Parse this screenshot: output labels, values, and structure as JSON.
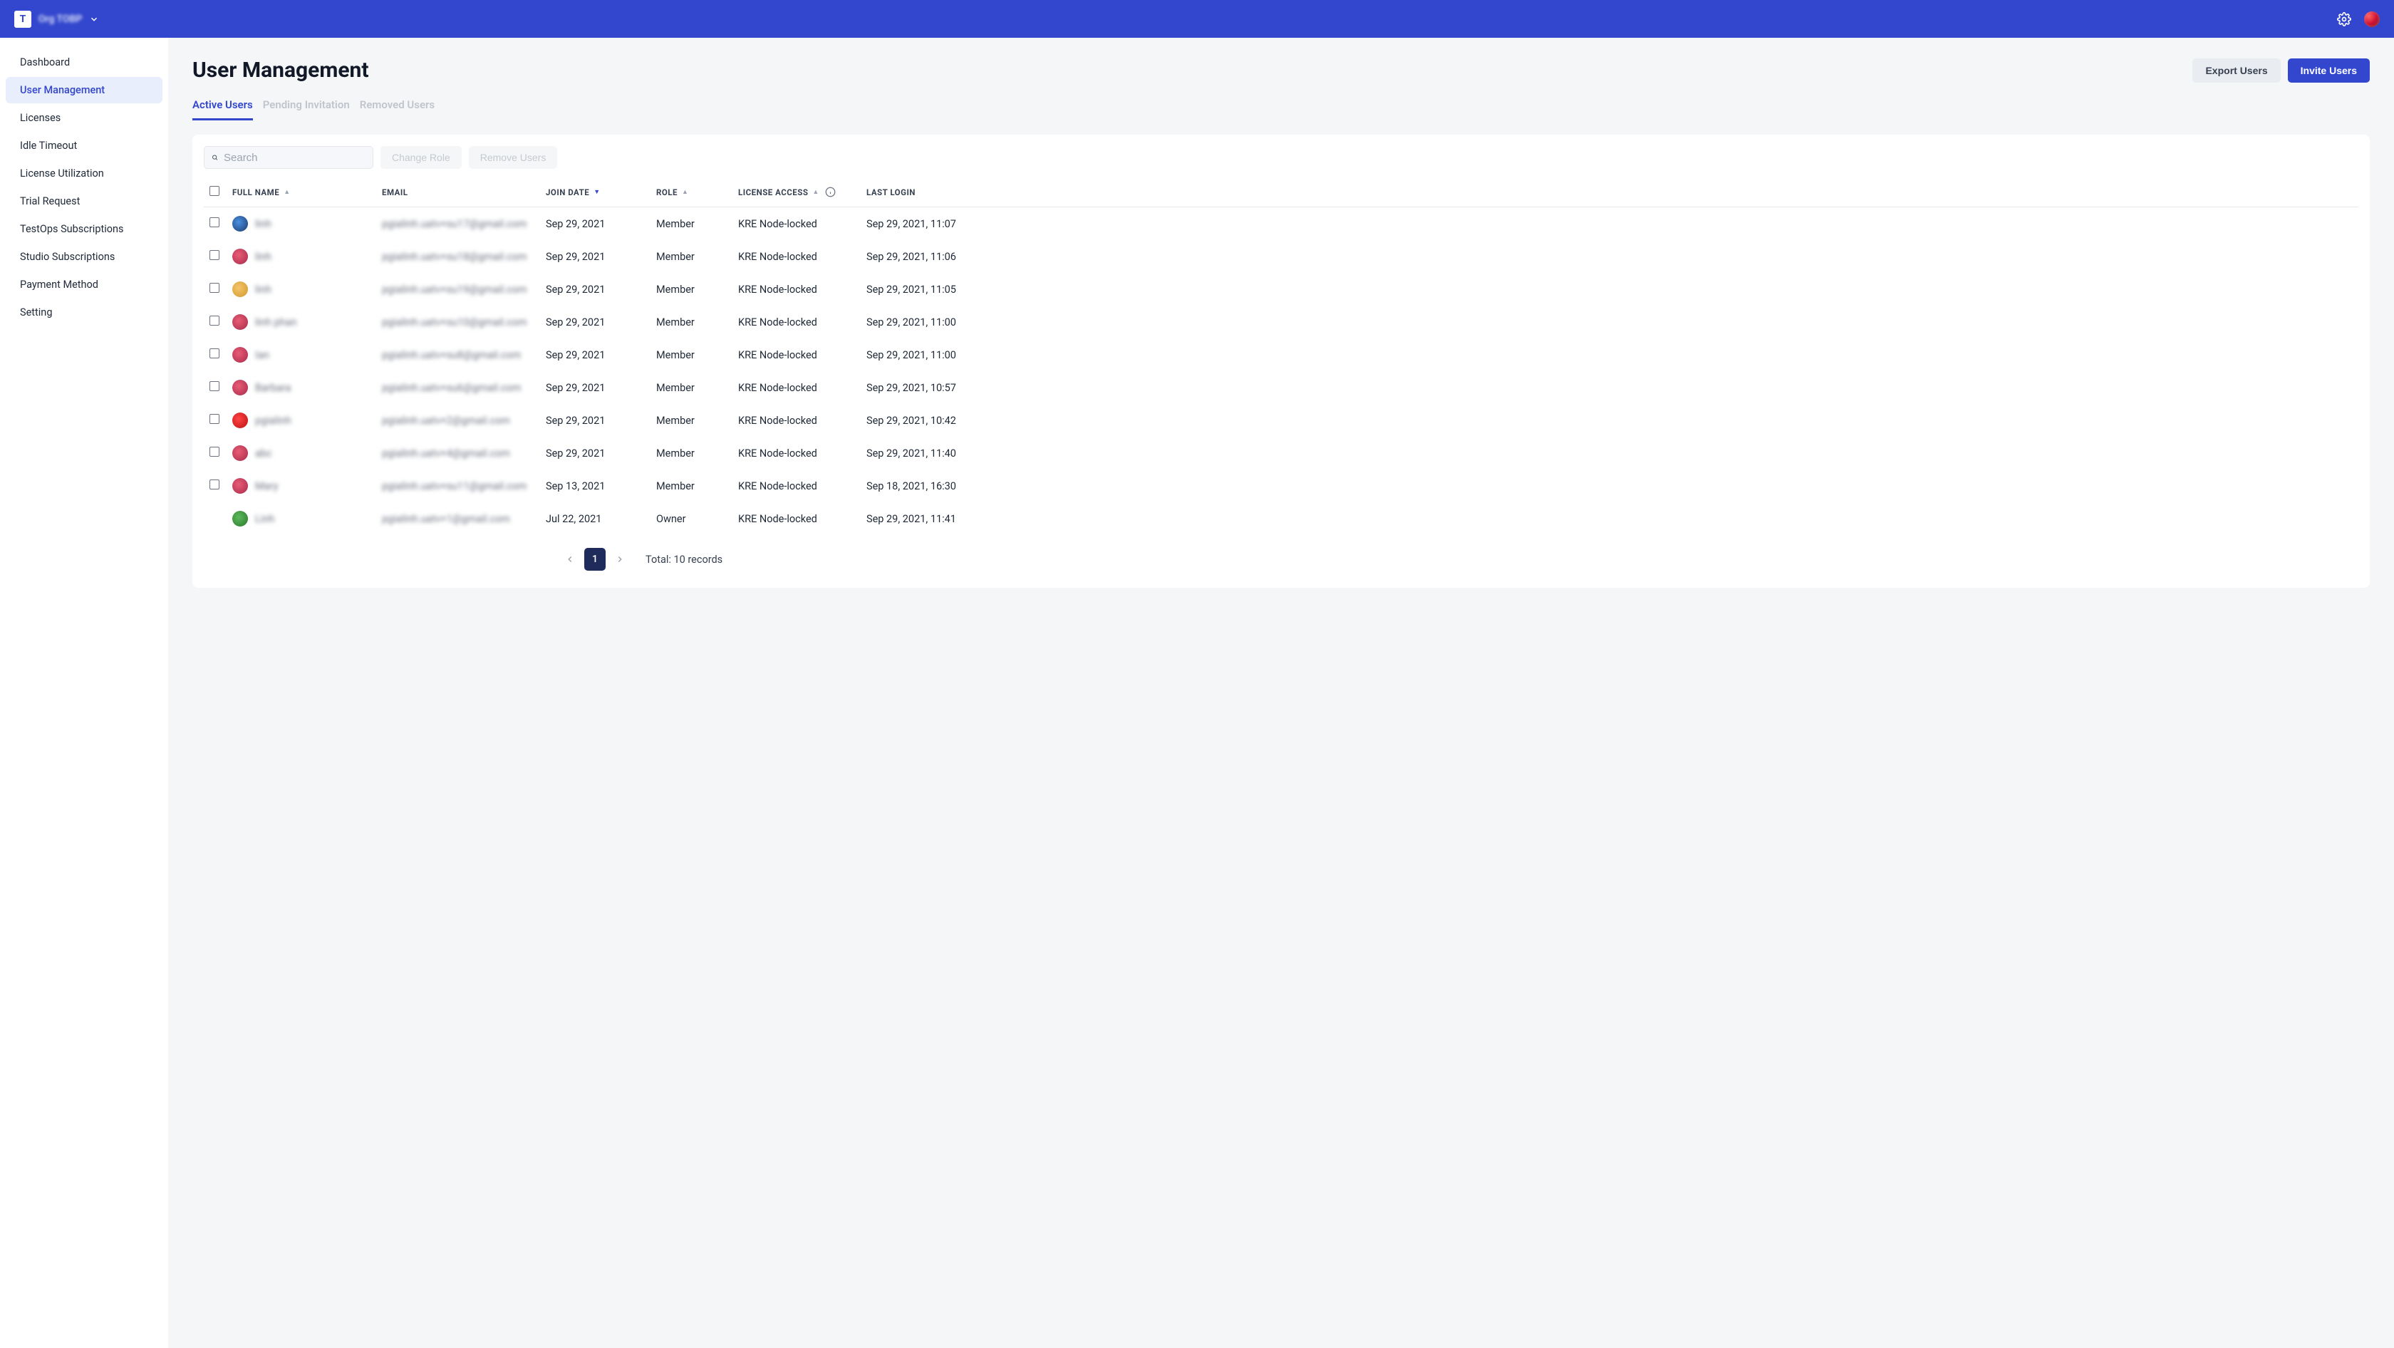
{
  "header": {
    "org_name": "Org TOBP"
  },
  "sidebar": {
    "items": [
      "Dashboard",
      "User Management",
      "Licenses",
      "Idle Timeout",
      "License Utilization",
      "Trial Request",
      "TestOps Subscriptions",
      "Studio Subscriptions",
      "Payment Method",
      "Setting"
    ],
    "active_index": 1
  },
  "page": {
    "title": "User Management",
    "export_label": "Export Users",
    "invite_label": "Invite Users"
  },
  "tabs": [
    {
      "label": "Active Users",
      "active": true
    },
    {
      "label": "Pending Invitation",
      "active": false
    },
    {
      "label": "Removed Users",
      "active": false
    }
  ],
  "toolbar": {
    "search_placeholder": "Search",
    "change_role_label": "Change Role",
    "remove_users_label": "Remove Users"
  },
  "columns": {
    "full_name": "FULL NAME",
    "email": "EMAIL",
    "join_date": "JOIN DATE",
    "role": "ROLE",
    "license_access": "LICENSE ACCESS",
    "last_login": "LAST LOGIN"
  },
  "rows": [
    {
      "name": "linh",
      "email": "pgialinh.uatv+su17@gmail.com",
      "join_date": "Sep 29, 2021",
      "role": "Member",
      "license": "KRE Node-locked",
      "last_login": "Sep 29, 2021, 11:07",
      "checkbox": true
    },
    {
      "name": "linh",
      "email": "pgialinh.uatv+su18@gmail.com",
      "join_date": "Sep 29, 2021",
      "role": "Member",
      "license": "KRE Node-locked",
      "last_login": "Sep 29, 2021, 11:06",
      "checkbox": true
    },
    {
      "name": "linh",
      "email": "pgialinh.uatv+su19@gmail.com",
      "join_date": "Sep 29, 2021",
      "role": "Member",
      "license": "KRE Node-locked",
      "last_login": "Sep 29, 2021, 11:05",
      "checkbox": true
    },
    {
      "name": "linh phan",
      "email": "pgialinh.uatv+su10@gmail.com",
      "join_date": "Sep 29, 2021",
      "role": "Member",
      "license": "KRE Node-locked",
      "last_login": "Sep 29, 2021, 11:00",
      "checkbox": true
    },
    {
      "name": "Ian",
      "email": "pgialinh.uatv+su8@gmail.com",
      "join_date": "Sep 29, 2021",
      "role": "Member",
      "license": "KRE Node-locked",
      "last_login": "Sep 29, 2021, 11:00",
      "checkbox": true
    },
    {
      "name": "Barbara",
      "email": "pgialinh.uatv+su6@gmail.com",
      "join_date": "Sep 29, 2021",
      "role": "Member",
      "license": "KRE Node-locked",
      "last_login": "Sep 29, 2021, 10:57",
      "checkbox": true
    },
    {
      "name": "pgialinh",
      "email": "pgialinh.uatv+2@gmail.com",
      "join_date": "Sep 29, 2021",
      "role": "Member",
      "license": "KRE Node-locked",
      "last_login": "Sep 29, 2021, 10:42",
      "checkbox": true
    },
    {
      "name": "abc",
      "email": "pgialinh.uatv+4@gmail.com",
      "join_date": "Sep 29, 2021",
      "role": "Member",
      "license": "KRE Node-locked",
      "last_login": "Sep 29, 2021, 11:40",
      "checkbox": true
    },
    {
      "name": "Mary",
      "email": "pgialinh.uatv+su11@gmail.com",
      "join_date": "Sep 13, 2021",
      "role": "Member",
      "license": "KRE Node-locked",
      "last_login": "Sep 18, 2021, 16:30",
      "checkbox": true
    },
    {
      "name": "Linh",
      "email": "pgialinh.uatv+1@gmail.com",
      "join_date": "Jul 22, 2021",
      "role": "Owner",
      "license": "KRE Node-locked",
      "last_login": "Sep 29, 2021, 11:41",
      "checkbox": false
    }
  ],
  "pagination": {
    "current_page": "1",
    "total_text": "Total: 10 records"
  }
}
